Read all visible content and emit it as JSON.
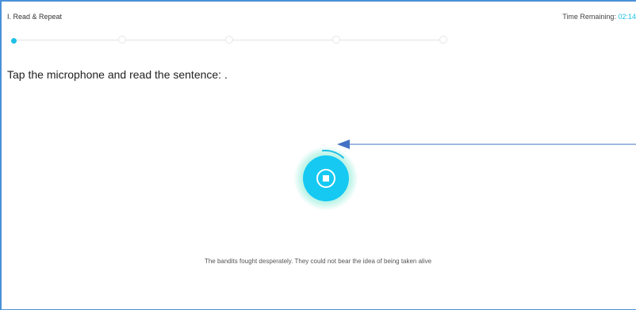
{
  "header": {
    "section_title": "I. Read & Repeat",
    "timer_label": "Time Remaining:",
    "timer_value": "02:14"
  },
  "progress": {
    "total_steps": 5,
    "current_step": 1
  },
  "instruction": "Tap the microphone and read the sentence: .",
  "recorder": {
    "state": "recording",
    "icon": "stop-icon"
  },
  "sentence": "The bandits fought desperately. They could not bear the idea of being taken alive",
  "colors": {
    "accent": "#1ec0e6",
    "mic": "#15c9f2",
    "glow": "#8eecd6",
    "arrow": "#4472c4",
    "frame": "#4a90d9"
  }
}
